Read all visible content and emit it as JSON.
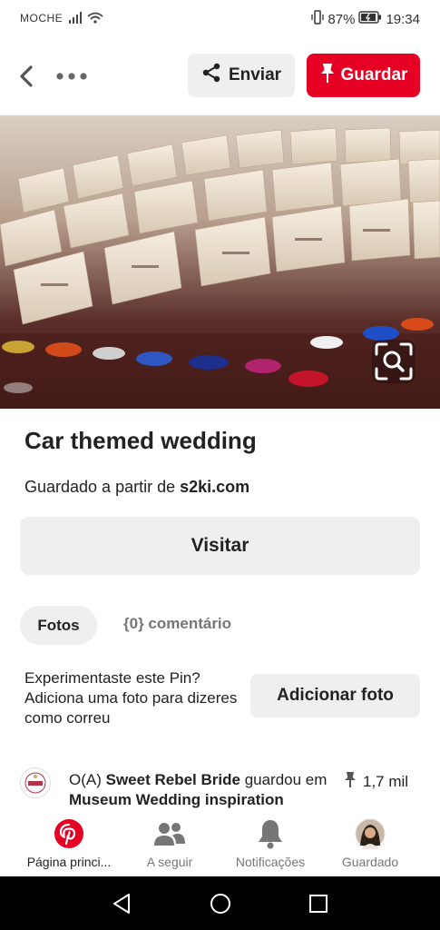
{
  "status_bar": {
    "carrier": "MOCHE",
    "battery": "87%",
    "time": "19:34"
  },
  "header": {
    "send_label": "Enviar",
    "save_label": "Guardar"
  },
  "pin": {
    "title": "Car themed wedding",
    "source_prefix": "Guardado a partir de",
    "source_domain": "s2ki.com",
    "visit_label": "Visitar"
  },
  "tabs": {
    "photos": "Fotos",
    "comments": "{0} comentário"
  },
  "try_it": {
    "text": "Experimentaste este Pin? Adiciona uma foto para dizeres como correu",
    "add_photo_label": "Adicionar foto"
  },
  "saved_by": {
    "prefix": "O(A)",
    "user": "Sweet Rebel Bride",
    "middle": "guardou em",
    "board": "Museum Wedding inspiration",
    "save_count": "1,7 mil"
  },
  "bottom_nav": {
    "home": "Página princi...",
    "following": "A seguir",
    "notifications": "Notificações",
    "saved": "Guardado"
  },
  "colors": {
    "accent": "#e60023",
    "surface": "#efefef",
    "muted": "#767676"
  }
}
